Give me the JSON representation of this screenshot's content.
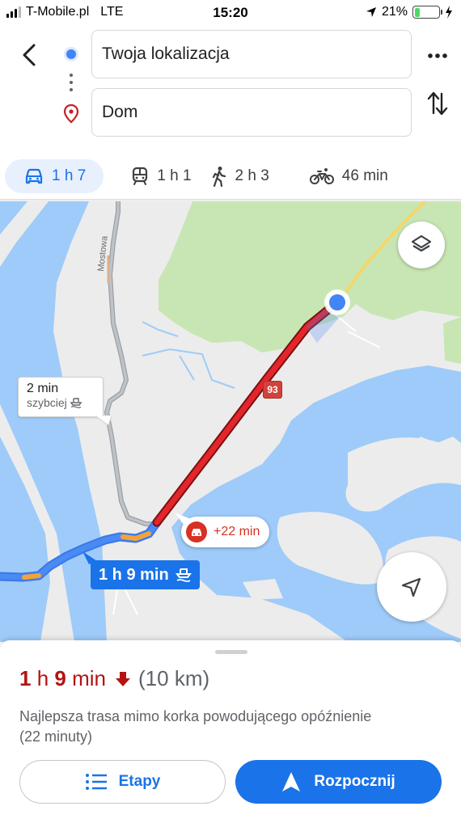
{
  "status_bar": {
    "carrier": "T-Mobile.pl",
    "network": "LTE",
    "time": "15:20",
    "battery": "21%",
    "battery_level": 0.21
  },
  "directions": {
    "origin": "Twoja lokalizacja",
    "destination": "Dom"
  },
  "modes": [
    {
      "icon": "car-icon",
      "label": "1 h 7",
      "active": true
    },
    {
      "icon": "train-icon",
      "label": "1 h 1",
      "active": false
    },
    {
      "icon": "walk-icon",
      "label": "2 h 3",
      "active": false
    },
    {
      "icon": "bike-icon",
      "label": "46 min",
      "active": false
    }
  ],
  "map": {
    "street_name": "Mostowa",
    "road_badge": "93",
    "alt_route_callout": {
      "time": "2 min",
      "subtitle": "szybciej"
    },
    "delay_badge": "+22 min",
    "route_label": "1 h 9 min"
  },
  "sheet": {
    "duration_hours": "1",
    "duration_h_unit": "h",
    "duration_minutes": "9",
    "duration_min_unit": "min",
    "distance": "(10 km)",
    "description": "Najlepsza trasa mimo korka powodującego opóźnienie (22 minuty)",
    "steps_button": "Etapy",
    "start_button": "Rozpocznij"
  },
  "colors": {
    "accent": "#1a73e8",
    "delay_red": "#d93025",
    "traffic_red": "#c5221f",
    "duration_red": "#b31412",
    "water": "#9ecbf9",
    "park": "#c8e6b4"
  }
}
